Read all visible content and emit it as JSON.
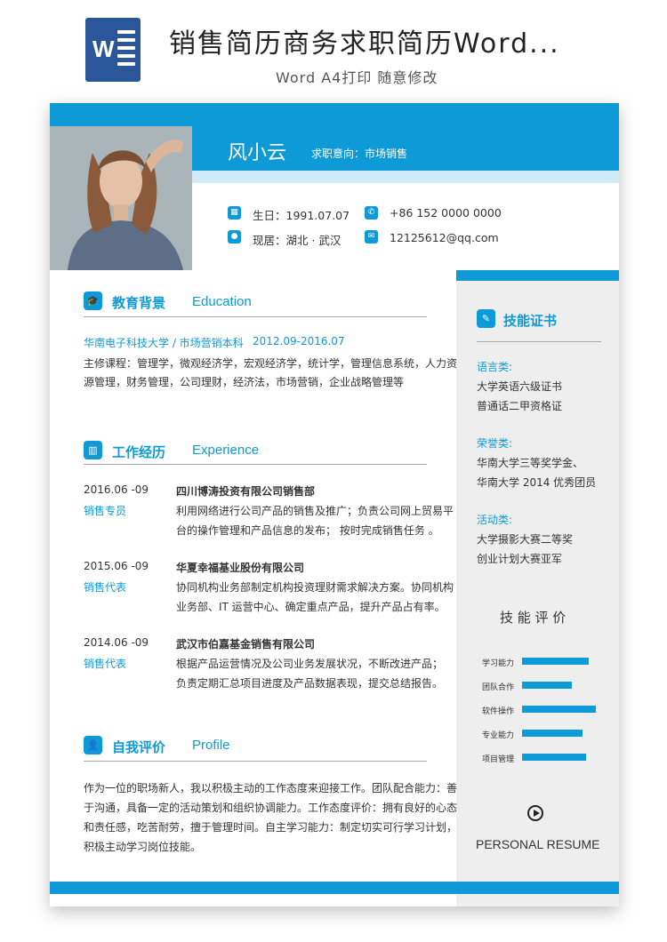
{
  "header": {
    "icon_letter": "W",
    "title": "销售简历商务求职简历Word...",
    "subtitle": "Word A4打印 随意修改"
  },
  "profile": {
    "name": "风小云",
    "intent": "求职意向：市场销售",
    "birth": "生日：1991.07.07",
    "phone": "+86 152 0000 0000",
    "location": "现居：湖北 · 武汉",
    "email": "12125612@qq.com"
  },
  "education": {
    "title_cn": "教育背景",
    "title_en": "Education",
    "school": "华南电子科技大学 / 市场营销本科",
    "period": "2012.09-2016.07",
    "courses_line1": "主修课程：管理学，微观经济学，宏观经济学，统计学，管理信息系统，人力资",
    "courses_line2": "源管理，财务管理，公司理财，经济法，市场营销，企业战略管理等"
  },
  "experience": {
    "title_cn": "工作经历",
    "title_en": "Experience",
    "jobs": [
      {
        "date": "2016.06 -09",
        "role": "销售专员",
        "company": "四川博涛投资有限公司销售部",
        "line1": "利用网络进行公司产品的销售及推广；负责公司网上贸易平",
        "line2": "台的操作管理和产品信息的发布；   按时完成销售任务 。"
      },
      {
        "date": "2015.06 -09",
        "role": "销售代表",
        "company": "华夏幸福基业股份有限公司",
        "line1": "协同机构业务部制定机构投资理财需求解决方案。协同机构",
        "line2": "业务部、IT 运营中心、确定重点产品，提升产品占有率。"
      },
      {
        "date": "2014.06 -09",
        "role": "销售代表",
        "company": "武汉市伯嘉基金销售有限公司",
        "line1": "根据产品运营情况及公司业务发展状况，不断改进产品；",
        "line2": "负责定期汇总项目进度及产品数据表现，提交总结报告。"
      }
    ]
  },
  "profile_section": {
    "title_cn": "自我评价",
    "title_en": "Profile",
    "lines": [
      "作为一位的职场新人，我以积极主动的工作态度来迎接工作。团队配合能力：善",
      "于沟通，具备一定的活动策划和组织协调能力。工作态度评价：拥有良好的心态",
      "和责任感，吃苦耐劳，擅于管理时间。自主学习能力：制定切实可行学习计划，",
      "积极主动学习岗位技能。"
    ]
  },
  "certificates": {
    "title": "技能证书",
    "groups": [
      {
        "label": "语言类:",
        "items": [
          "大学英语六级证书",
          "普通话二甲资格证"
        ]
      },
      {
        "label": "荣誉类:",
        "items": [
          "华南大学三等奖学金、",
          "华南大学 2014 优秀团员"
        ]
      },
      {
        "label": "活动类:",
        "items": [
          "大学摄影大赛二等奖",
          "创业计划大赛亚军"
        ]
      }
    ]
  },
  "skills": {
    "title": "技 能 评 价",
    "items": [
      {
        "name": "学习能力",
        "level": 0.82
      },
      {
        "name": "团队合作",
        "level": 0.61
      },
      {
        "name": "软件操作",
        "level": 0.9
      },
      {
        "name": "专业能力",
        "level": 0.74
      },
      {
        "name": "项目管理",
        "level": 0.78
      }
    ]
  },
  "footer": {
    "tagline": "PERSONAL RESUME"
  },
  "colors": {
    "accent": "#0e9ad7",
    "light_accent": "#cfe9f6",
    "sidebar": "#eeeeee"
  }
}
